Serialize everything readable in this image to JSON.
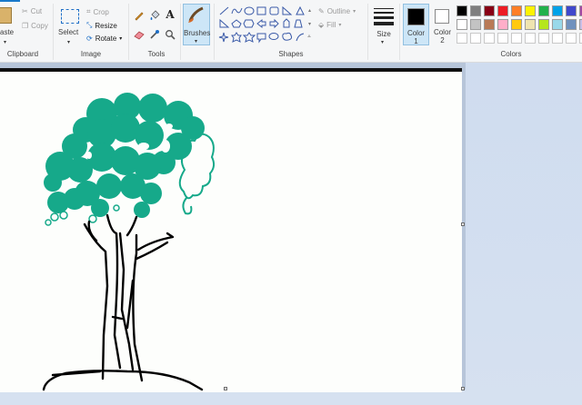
{
  "clipboard": {
    "group_label": "Clipboard",
    "paste_label": "aste",
    "cut_label": "Cut",
    "copy_label": "Copy"
  },
  "image": {
    "group_label": "Image",
    "select_label": "Select",
    "crop_label": "Crop",
    "resize_label": "Resize",
    "rotate_label": "Rotate"
  },
  "tools": {
    "group_label": "Tools",
    "items": [
      "pencil-icon",
      "fill-icon",
      "text-icon",
      "eraser-icon",
      "color-picker-icon",
      "magnifier-icon"
    ]
  },
  "brushes": {
    "label": "Brushes"
  },
  "shapes": {
    "group_label": "Shapes",
    "outline_label": "Outline",
    "fill_label": "Fill"
  },
  "size": {
    "label": "Size"
  },
  "color1": {
    "label_line1": "Color",
    "label_line2": "1",
    "value": "#000000"
  },
  "color2": {
    "label_line1": "Color",
    "label_line2": "2",
    "value": "#ffffff"
  },
  "colors": {
    "group_label": "Colors",
    "row1": [
      "#000000",
      "#7f7f7f",
      "#880015",
      "#ed1c24",
      "#ff7f27",
      "#fff200",
      "#22b14c",
      "#00a2e8",
      "#3f48cc",
      "#a349a4"
    ],
    "row2": [
      "#ffffff",
      "#c3c3c3",
      "#b97a57",
      "#ffaec9",
      "#ffc90e",
      "#efe4b0",
      "#b5e61d",
      "#99d9ea",
      "#7092be",
      "#c8bfe7"
    ],
    "row3": [
      "#ffffff",
      "#ffffff",
      "#ffffff",
      "#ffffff",
      "#ffffff",
      "#ffffff",
      "#ffffff",
      "#ffffff",
      "#ffffff",
      "#ffffff"
    ]
  },
  "drawing": {
    "foliage_color": "#16a98a",
    "stroke_color": "#000000"
  }
}
